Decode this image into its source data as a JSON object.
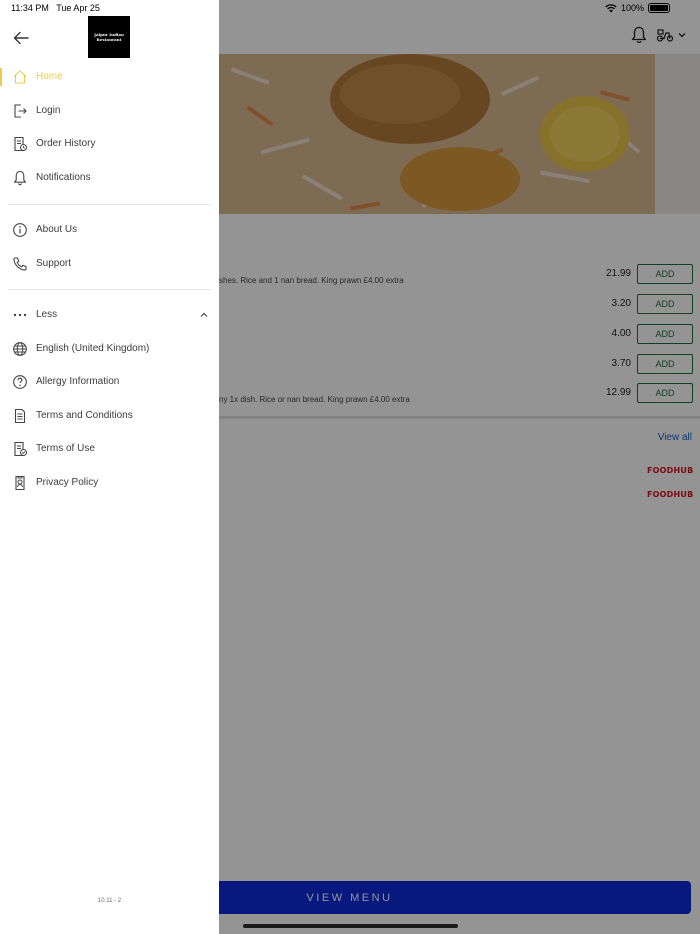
{
  "status_bar": {
    "time": "11:34 PM",
    "date": "Tue Apr 25",
    "battery": "100%"
  },
  "drawer": {
    "logo_lines": [
      "Jaipur Indian",
      "Restaurant"
    ],
    "nav_primary": [
      {
        "label": "Home",
        "icon": "home-icon",
        "active": true
      },
      {
        "label": "Login",
        "icon": "login-icon",
        "active": false
      },
      {
        "label": "Order History",
        "icon": "receipt-icon",
        "active": false
      },
      {
        "label": "Notifications",
        "icon": "bell-icon",
        "active": false
      }
    ],
    "nav_secondary": [
      {
        "label": "About Us",
        "icon": "info-icon"
      },
      {
        "label": "Support",
        "icon": "phone-icon"
      }
    ],
    "less_label": "Less",
    "nav_more": [
      {
        "label": "English (United Kingdom)",
        "icon": "globe-icon"
      },
      {
        "label": "Allergy Information",
        "icon": "help-circle-icon"
      },
      {
        "label": "Terms and Conditions",
        "icon": "document-icon"
      },
      {
        "label": "Terms of Use",
        "icon": "document-check-icon"
      },
      {
        "label": "Privacy Policy",
        "icon": "privacy-icon"
      }
    ],
    "version": "10.11 - 2",
    "accent_color": "#f2c84b"
  },
  "menu": {
    "items": [
      {
        "desc": "shes. Rice and 1 nan bread. King prawn £4.00 extra",
        "price": "21.99",
        "button": "ADD"
      },
      {
        "desc": "",
        "price": "3.20",
        "button": "ADD"
      },
      {
        "desc": "",
        "price": "4.00",
        "button": "ADD"
      },
      {
        "desc": "",
        "price": "3.70",
        "button": "ADD"
      },
      {
        "desc": "ny 1x dish. Rice or nan bread. King prawn £4.00 extra",
        "price": "12.99",
        "button": "ADD"
      }
    ],
    "view_all": "View all",
    "brand_badges": [
      "FOODHUB",
      "FOODHUB"
    ],
    "view_menu_button": "VIEW MENU",
    "button_color": "#0d2cd9"
  }
}
